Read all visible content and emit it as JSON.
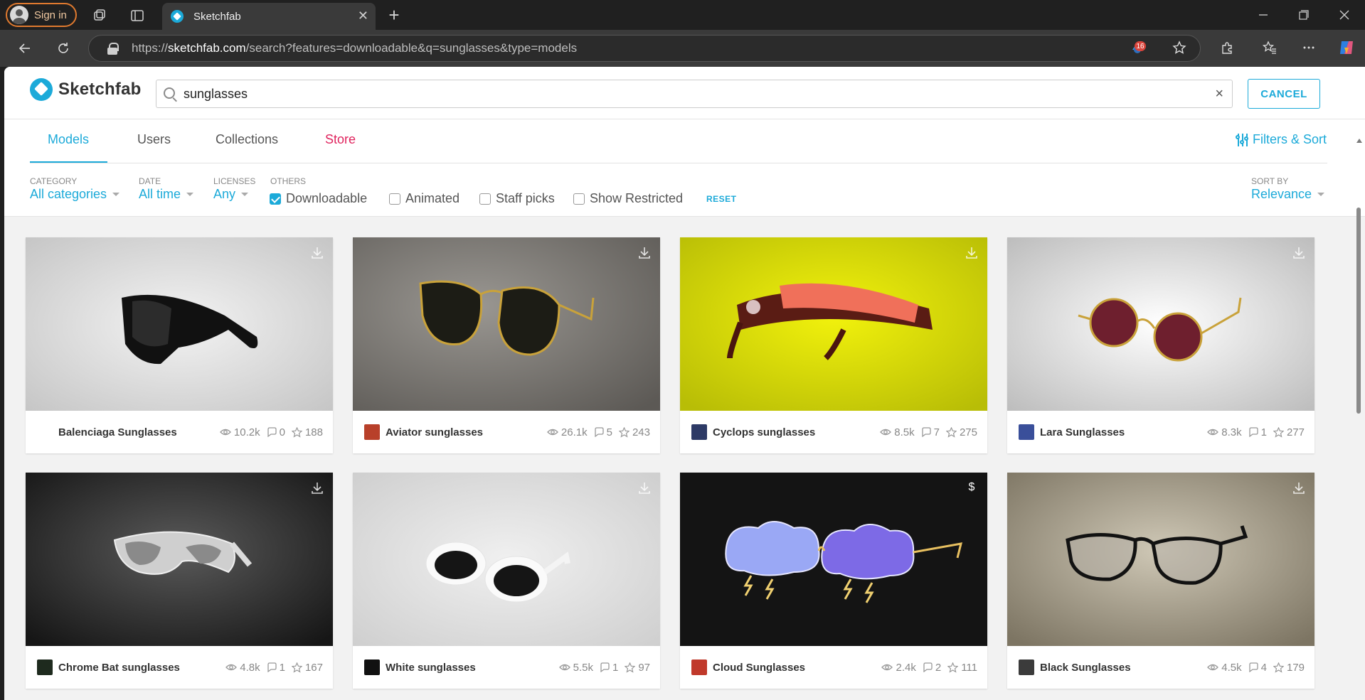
{
  "browser": {
    "signin_label": "Sign in",
    "tab_title": "Sketchfab",
    "url_prefix": "https://",
    "url_host": "sketchfab.com",
    "url_path": "/search?features=downloadable&q=sunglasses&type=models",
    "extension_badge": "16"
  },
  "header": {
    "logo_text": "Sketchfab",
    "search_value": "sunglasses",
    "cancel_label": "CANCEL"
  },
  "nav": {
    "tabs": [
      {
        "label": "Models"
      },
      {
        "label": "Users"
      },
      {
        "label": "Collections"
      },
      {
        "label": "Store"
      }
    ],
    "filters_label": "Filters & Sort"
  },
  "filters": {
    "category": {
      "label": "CATEGORY",
      "value": "All categories"
    },
    "date": {
      "label": "DATE",
      "value": "All time"
    },
    "licenses": {
      "label": "LICENSES",
      "value": "Any"
    },
    "others_label": "OTHERS",
    "checkboxes": [
      {
        "label": "Downloadable",
        "checked": true
      },
      {
        "label": "Animated",
        "checked": false
      },
      {
        "label": "Staff picks",
        "checked": false
      },
      {
        "label": "Show Restricted",
        "checked": false
      }
    ],
    "reset_label": "RESET",
    "sort": {
      "label": "SORT BY",
      "value": "Relevance"
    }
  },
  "models": [
    {
      "title": "Balenciaga Sunglasses",
      "views": "10.2k",
      "comments": "0",
      "likes": "188",
      "action": "download",
      "bg": "#d6d6d6",
      "avatar": "#ffffff"
    },
    {
      "title": "Aviator sunglasses",
      "views": "26.1k",
      "comments": "5",
      "likes": "243",
      "action": "download",
      "bg": "#7a7672",
      "avatar": "#b8402a"
    },
    {
      "title": "Cyclops sunglasses",
      "views": "8.5k",
      "comments": "7",
      "likes": "275",
      "action": "download",
      "bg": "#d8dc0a",
      "avatar": "#2d3a66"
    },
    {
      "title": "Lara Sunglasses",
      "views": "8.3k",
      "comments": "1",
      "likes": "277",
      "action": "download",
      "bg": "#e6e6e6",
      "avatar": "#3a4f9a"
    },
    {
      "title": "Chrome Bat sunglasses",
      "views": "4.8k",
      "comments": "1",
      "likes": "167",
      "action": "download",
      "bg": "#3a3a3a",
      "avatar": "#1e2a1e"
    },
    {
      "title": "White sunglasses",
      "views": "5.5k",
      "comments": "1",
      "likes": "97",
      "action": "download",
      "bg": "#dedede",
      "avatar": "#111111"
    },
    {
      "title": "Cloud Sunglasses",
      "views": "2.4k",
      "comments": "2",
      "likes": "111",
      "action": "price",
      "price_symbol": "$",
      "bg": "#151515",
      "avatar": "#c0392b"
    },
    {
      "title": "Black Sunglasses",
      "views": "4.5k",
      "comments": "4",
      "likes": "179",
      "action": "download",
      "bg": "#a59d88",
      "avatar": "#3b3b3b"
    }
  ]
}
